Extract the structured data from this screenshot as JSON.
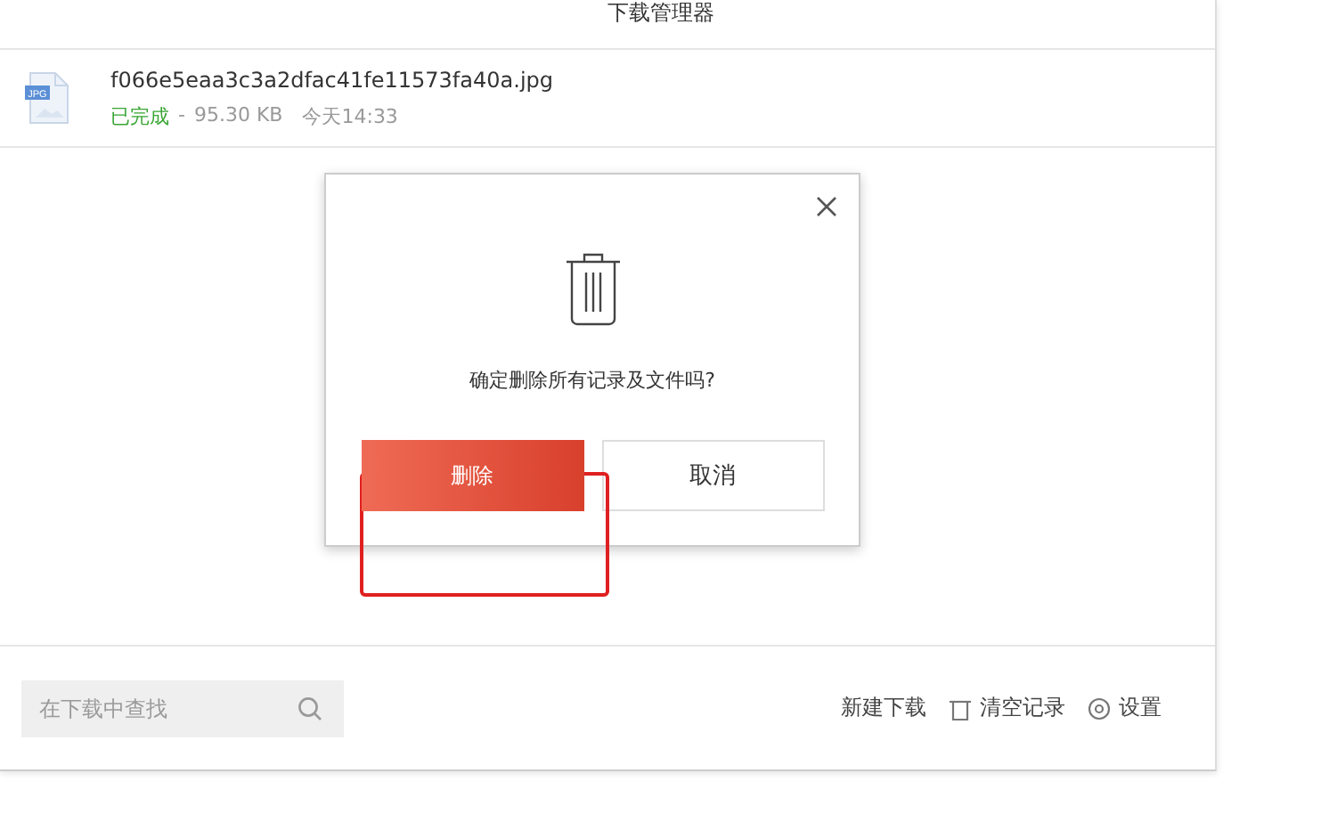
{
  "window": {
    "title": "下载管理器"
  },
  "downloads": [
    {
      "type_badge": "JPG",
      "file_name": "f066e5eaa3c3a2dfac41fe11573fa40a.jpg",
      "status": "已完成",
      "separator": "-",
      "size": "95.30 KB",
      "time": "今天14:33"
    }
  ],
  "dialog": {
    "message": "确定删除所有记录及文件吗?",
    "buttons": [
      {
        "label": "删除",
        "kind": "primary"
      },
      {
        "label": "取消",
        "kind": "secondary"
      }
    ]
  },
  "footer": {
    "search": {
      "placeholder": "在下载中查找"
    },
    "actions": [
      {
        "label": "新建下载",
        "kind": "new"
      },
      {
        "label": "清空记录",
        "kind": "clear"
      },
      {
        "label": "设置",
        "kind": "settings"
      }
    ]
  }
}
